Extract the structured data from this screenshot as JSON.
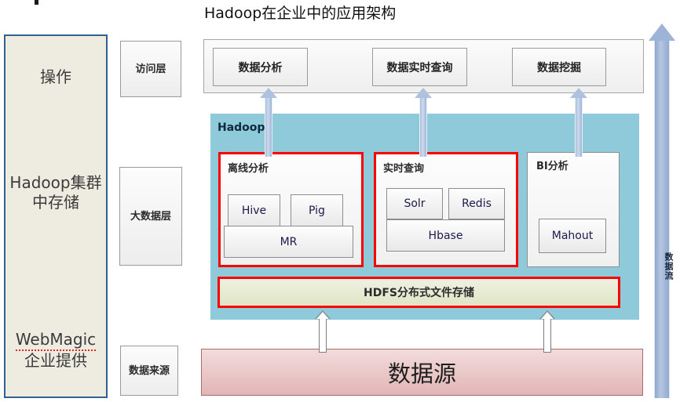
{
  "title": "Hadoop在企业中的应用架构",
  "left_column": {
    "items": [
      {
        "label": "操作"
      },
      {
        "label": "Hadoop集群中存储"
      },
      {
        "label_underlined": "WebMagic",
        "label_rest": "企业提供"
      }
    ]
  },
  "layers": [
    {
      "label": "访问层"
    },
    {
      "label": "大数据层"
    },
    {
      "label": "数据来源"
    }
  ],
  "access_layer": {
    "boxes": [
      {
        "label": "数据分析"
      },
      {
        "label": "数据实时查询"
      },
      {
        "label": "数据挖掘"
      }
    ]
  },
  "hadoop_panel": {
    "label": "Hadoop",
    "panel_color": "#8ecad9",
    "groups": [
      {
        "title": "离线分析",
        "border_color": "#fa0000",
        "chips": [
          {
            "label": "Hive"
          },
          {
            "label": "Pig"
          },
          {
            "label": "MR"
          }
        ]
      },
      {
        "title": "实时查询",
        "border_color": "#fa0000",
        "chips": [
          {
            "label": "Solr"
          },
          {
            "label": "Redis"
          },
          {
            "label": "Hbase"
          }
        ]
      },
      {
        "title": "BI分析",
        "border_color": "#8d8d8d",
        "chips": [
          {
            "label": "Mahout"
          }
        ]
      }
    ],
    "storage": {
      "label": "HDFS分布式文件存储",
      "border_color": "#fa0000"
    }
  },
  "data_source": {
    "label": "数据源"
  },
  "data_flow": {
    "label": "数据流"
  }
}
